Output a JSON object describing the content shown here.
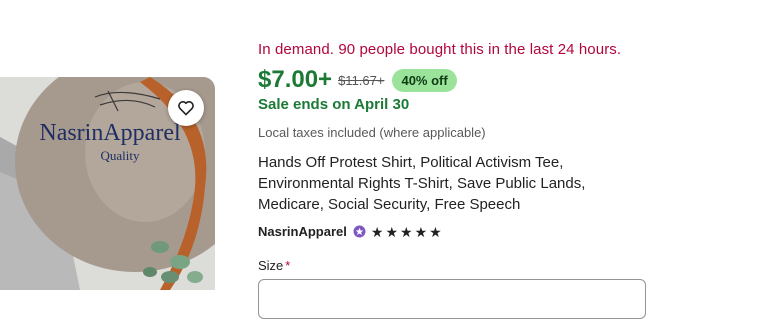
{
  "listing": {
    "demand_text": "In demand. 90 people bought this in the last 24 hours.",
    "price": "$7.00+",
    "original_price": "$11.67+",
    "discount_badge": "40% off",
    "sale_ends": "Sale ends on April 30",
    "tax_note": "Local taxes included (where applicable)",
    "title_lines": [
      "Hands Off Protest Shirt, Political Activism Tee,",
      "Environmental Rights T-Shirt, Save Public Lands,",
      "Medicare, Social Security, Free Speech"
    ],
    "shop_name": "NasrinApparel",
    "rating_stars": 5,
    "size_label": "Size",
    "size_required_marker": "*"
  },
  "image": {
    "brand_text": "NasrinApparel",
    "tagline": "Quality"
  },
  "colors": {
    "demand": "#b3063b",
    "price": "#1c7a36",
    "badge_bg": "#9be29b"
  },
  "icons": {
    "favorite": "heart-icon",
    "star_seller": "star-seller-badge-icon",
    "rating": "star-icon"
  }
}
